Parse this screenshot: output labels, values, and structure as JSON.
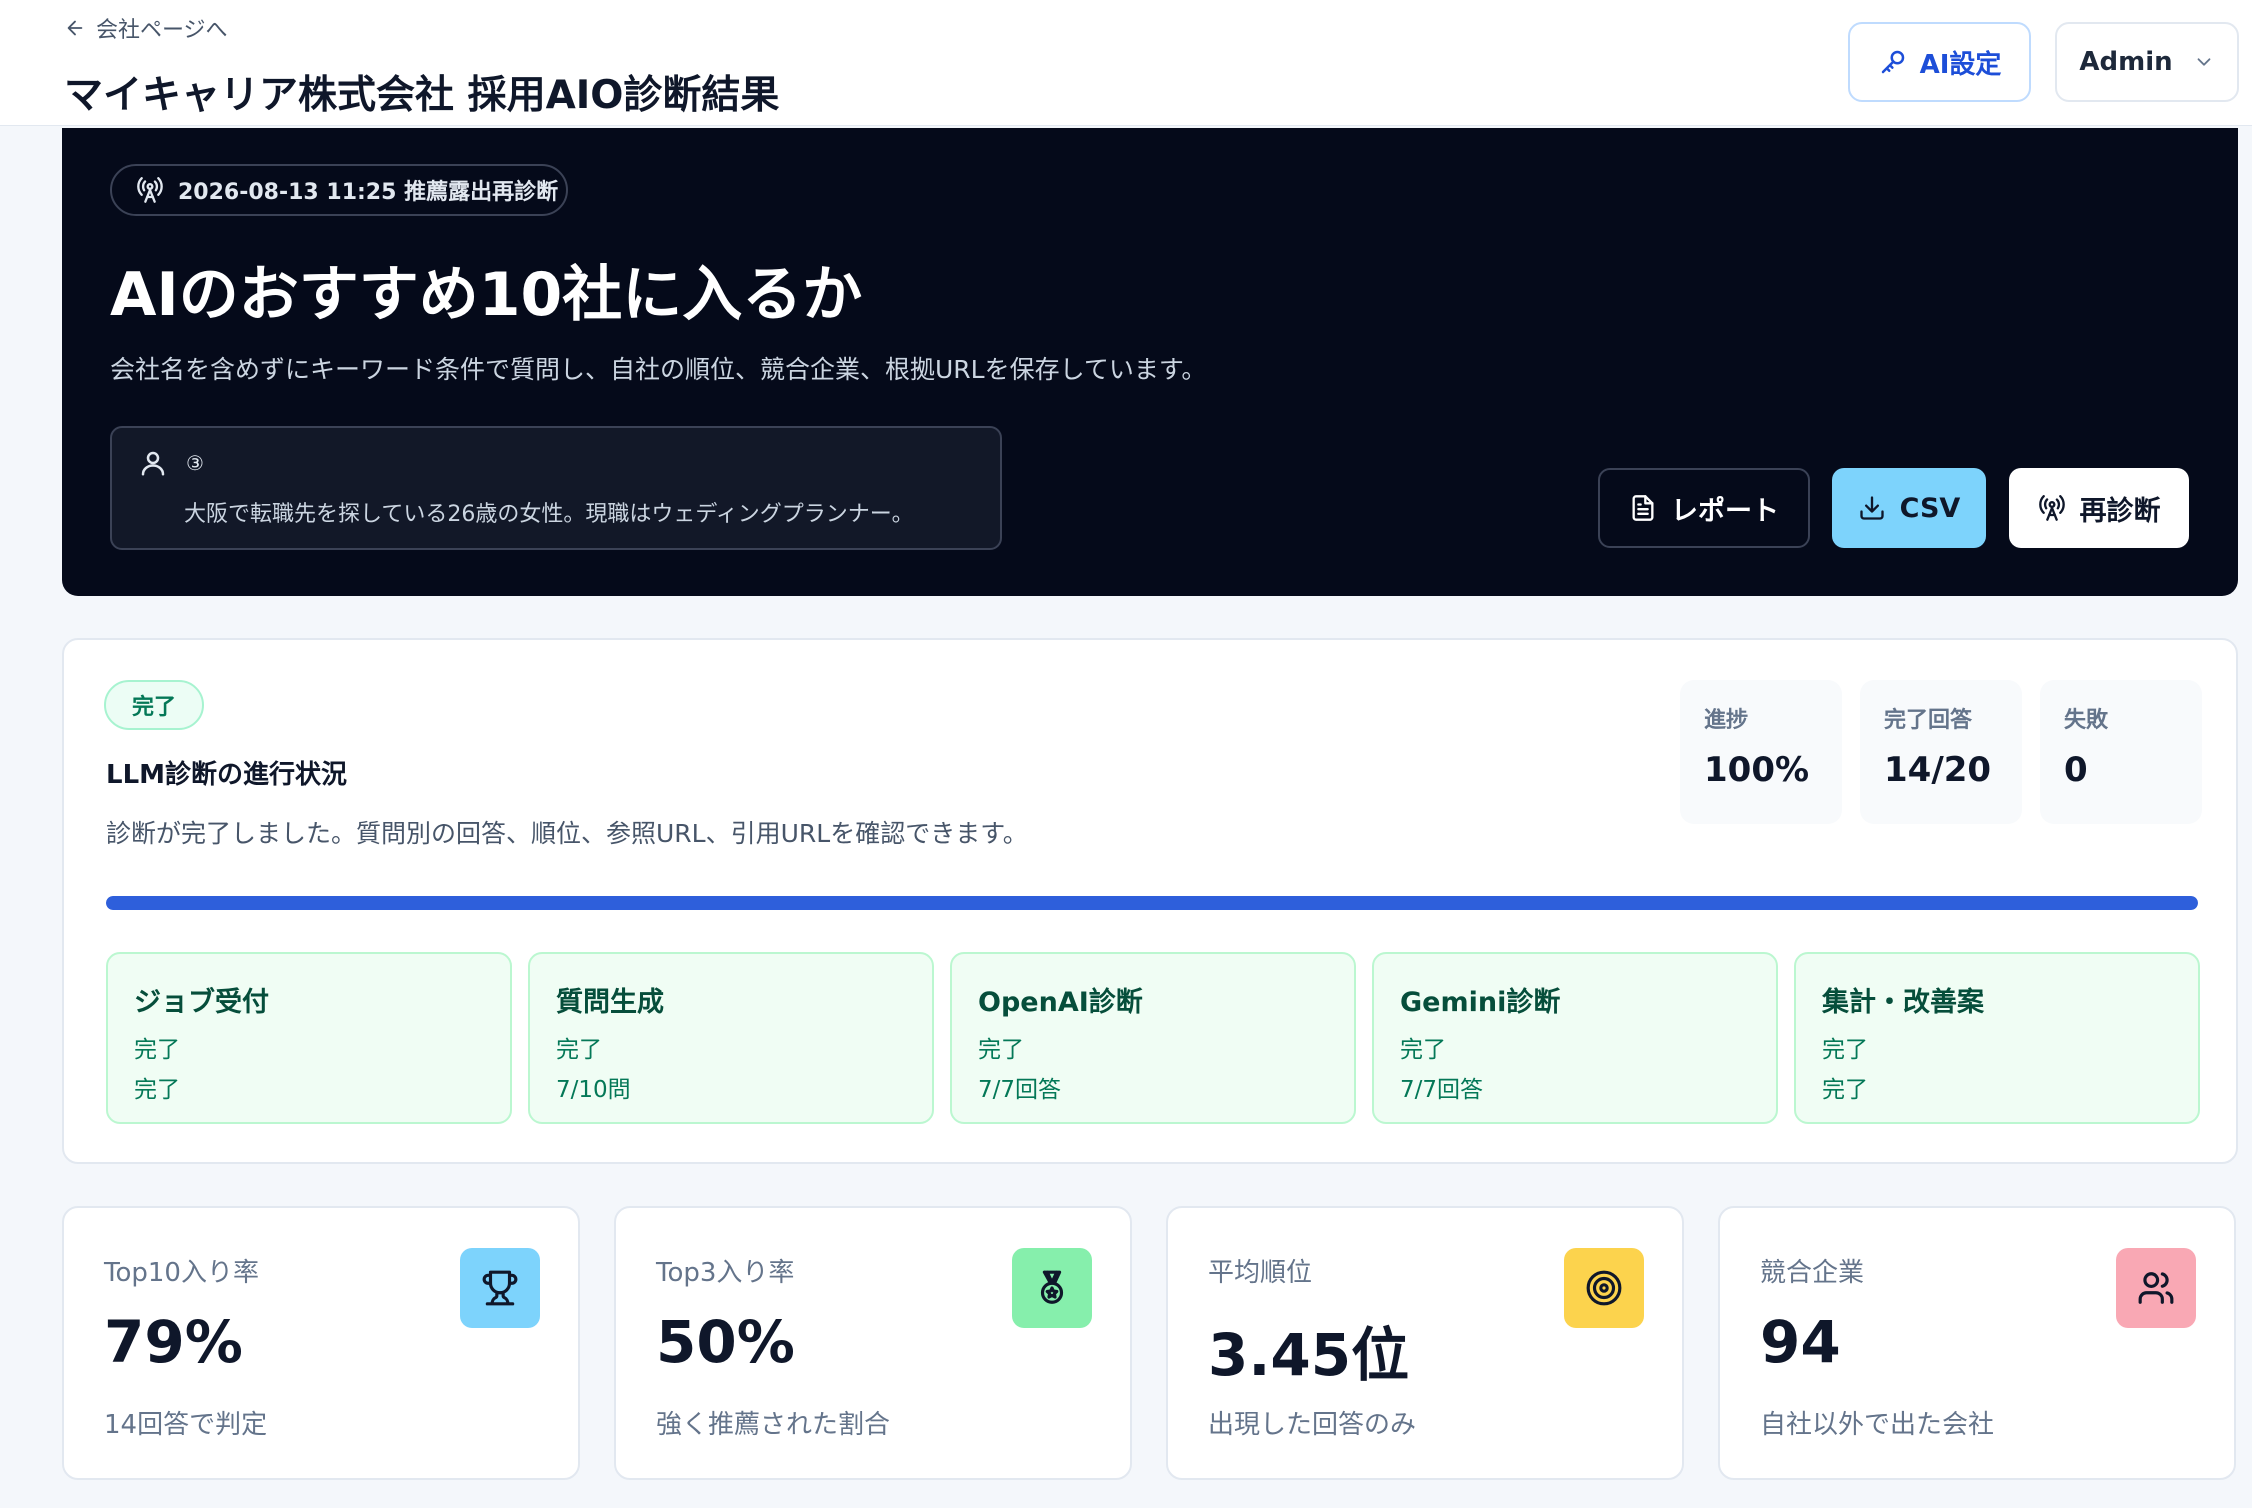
{
  "header": {
    "back_label": "会社ページへ",
    "title": "マイキャリア株式会社 採用AIO診断結果",
    "ai_settings_label": "AI設定",
    "admin_label": "Admin"
  },
  "hero": {
    "badge": "2026-08-13 11:25 推薦露出再診断",
    "title": "AIのおすすめ10社に入るか",
    "description": "会社名を含めずにキーワード条件で質問し、自社の順位、競合企業、根拠URLを保存しています。",
    "persona_number": "③",
    "persona_text": "大阪で転職先を探している26歳の女性。現職はウェディングプランナー。",
    "buttons": {
      "report": "レポート",
      "csv": "CSV",
      "rediagnose": "再診断"
    }
  },
  "progress": {
    "badge": "完了",
    "title": "LLM診断の進行状況",
    "description": "診断が完了しました。質問別の回答、順位、参照URL、引用URLを確認できます。",
    "progress_fraction": 1.0,
    "stats": [
      {
        "label": "進捗",
        "value": "100%"
      },
      {
        "label": "完了回答",
        "value": "14/20"
      },
      {
        "label": "失敗",
        "value": "0"
      }
    ],
    "steps": [
      {
        "name": "ジョブ受付",
        "status": "完了",
        "detail": "完了"
      },
      {
        "name": "質問生成",
        "status": "完了",
        "detail": "7/10問"
      },
      {
        "name": "OpenAI診断",
        "status": "完了",
        "detail": "7/7回答"
      },
      {
        "name": "Gemini診断",
        "status": "完了",
        "detail": "7/7回答"
      },
      {
        "name": "集計・改善案",
        "status": "完了",
        "detail": "完了"
      }
    ]
  },
  "metrics": [
    {
      "label": "Top10入り率",
      "value": "79%",
      "sub": "14回答で判定",
      "icon": "trophy-icon",
      "icon_bg": "#7dd3fc"
    },
    {
      "label": "Top3入り率",
      "value": "50%",
      "sub": "強く推薦された割合",
      "icon": "medal-icon",
      "icon_bg": "#86efac"
    },
    {
      "label": "平均順位",
      "value": "3.45位",
      "sub": "出現した回答のみ",
      "icon": "target-icon",
      "icon_bg": "#fcd34d"
    },
    {
      "label": "競合企業",
      "value": "94",
      "sub": "自社以外で出た会社",
      "icon": "users-icon",
      "icon_bg": "#f9a8b4"
    }
  ],
  "colors": {
    "accent_blue": "#2e5fdb",
    "hero_bg": "#050a1a",
    "success_green": "#047857"
  }
}
